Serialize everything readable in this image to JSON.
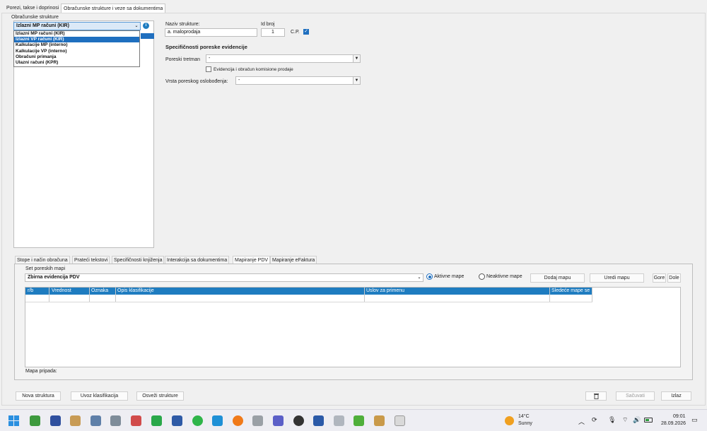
{
  "top_tabs": [
    "Porezi, takse i doprinosi",
    "Obračunske strukture i veze sa dokumentima"
  ],
  "left_panel": {
    "title": "Obračunske strukture",
    "combo_value": "Izlazni MP računi (KIR)",
    "list_items": [
      "Izlazni MP računi (KIR)",
      "Izlazni VP računi (KIR)",
      "Kalkulacije MP (interno)",
      "Kalkulacije VP (interno)",
      "Obračuni primanja",
      "Ulazni računi (KPR)"
    ],
    "selected_index": 1
  },
  "form": {
    "naziv_label": "Naziv strukture:",
    "naziv_value": "a. maloprodaja",
    "id_label": "Id broj",
    "id_value": "1",
    "cp_label": "C.P.",
    "section_title": "Specifičnosti poreske evidencije",
    "poreski_tretman_label": "Poreski tretman",
    "poreski_tretman_value": "-",
    "evid_checkbox_label": "Evidencija i obračun komisione prodaje",
    "vrsta_label": "Vrsta poreskog oslobođenja:",
    "vrsta_value": "-"
  },
  "bottom_tabs": [
    "Stope i način obračuna",
    "Prateći tekstovi",
    "Specifičnosti knjiženja",
    "Interakcija sa dokumentima",
    "Mapiranje PDV",
    "Mapiranje eFaktura"
  ],
  "mapping": {
    "set_label": "Set poreskih mapi",
    "set_value": "Zbirna evidencija PDV",
    "radio_active": "Aktivne mape",
    "radio_inactive": "Neaktivne mape",
    "btn_add": "Dodaj mapu",
    "btn_edit": "Uredi mapu",
    "btn_up": "Gore",
    "btn_down": "Dole",
    "columns": [
      "r/b",
      "Vrednost",
      "Oznaka",
      "Opis klasifikacije",
      "Uslov za primenu",
      "Sledeće mape se"
    ],
    "footer_label": "Mapa pripada:"
  },
  "bottom_buttons": {
    "new": "Nova struktura",
    "import": "Uvoz klasifikacija",
    "refresh": "Osveži strukture",
    "save": "Sačuvati",
    "exit": "Izlaz"
  },
  "taskbar": {
    "weather_temp": "14°C",
    "weather_desc": "Sunny",
    "time": "09:01",
    "date": "28.09.2026"
  },
  "colors": {
    "accent": "#1e7cc0",
    "selection": "#1f6fbf",
    "weather_sun": "#f0a020"
  }
}
